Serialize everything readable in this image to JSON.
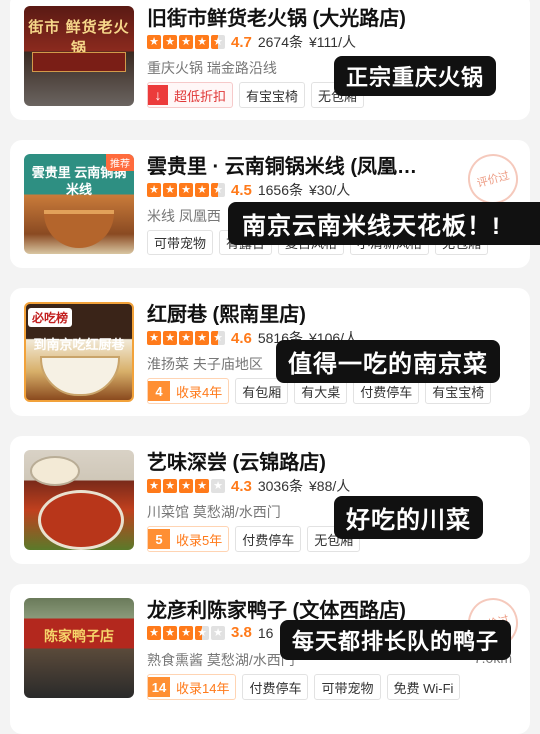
{
  "restaurants": [
    {
      "name": "旧街市鲜货老火锅 (大光路店)",
      "rating": 4.7,
      "score": "4.7",
      "reviews": "2674条",
      "price": "¥111/人",
      "area": "重庆火锅  瑞金路沿线",
      "distance": "",
      "tags": [
        "超低折扣",
        "有宝宝椅",
        "无包厢"
      ],
      "overlay": "正宗重庆火锅",
      "thumb_text": "街市 鲜货老火锅"
    },
    {
      "name": "雲贵里 · 云南铜锅米线 (凤凰…",
      "rating": 4.5,
      "score": "4.5",
      "reviews": "1656条",
      "price": "¥30/人",
      "area": "米线 凤凰西",
      "distance": "",
      "tags": [
        "可带宠物",
        "有露台",
        "复古风格",
        "小清新风格",
        "无包厢"
      ],
      "overlay": "南京云南米线天花板！!",
      "stamp": "评价过",
      "badge": "推荐",
      "thumb_text": "雲贵里 云南铜锅米线"
    },
    {
      "name": "红厨巷 (熙南里店)",
      "rating": 4.6,
      "score": "4.6",
      "reviews": "5816条",
      "price": "¥106/人",
      "area": "淮扬菜 夫子庙地区",
      "distance": "",
      "fav_years": "4",
      "fav_label": "收录4年",
      "tags": [
        "有包厢",
        "有大桌",
        "付费停车",
        "有宝宝椅"
      ],
      "overlay": "值得一吃的南京菜",
      "thumb_text": "必吃榜 到南京吃红厨巷",
      "thumb_badge": "必吃榜"
    },
    {
      "name": "艺味深尝 (云锦路店)",
      "rating": 4.3,
      "score": "4.3",
      "reviews": "3036条",
      "price": "¥88/人",
      "area": "川菜馆 莫愁湖/水西门",
      "distance": "",
      "fav_years": "5",
      "fav_label": "收录5年",
      "tags": [
        "付费停车",
        "无包厢"
      ],
      "overlay": "好吃的川菜"
    },
    {
      "name": "龙彦利陈家鸭子 (文体西路店)",
      "rating": 3.8,
      "score": "3.8",
      "reviews": "16",
      "price": "",
      "area": "熟食熏酱 莫愁湖/水西门",
      "distance": "7.0km",
      "fav_years": "14",
      "fav_label": "收录14年",
      "tags": [
        "付费停车",
        "可带宠物",
        "免费 Wi-Fi"
      ],
      "overlay": "每天都排长队的鸭子",
      "stamp": "评价过",
      "thumb_text": "陈家鸭子店"
    }
  ]
}
